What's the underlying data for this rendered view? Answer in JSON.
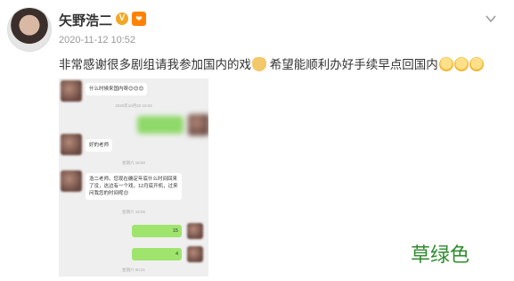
{
  "post": {
    "username": "矢野浩二",
    "verified_badge": "V",
    "timestamp": "2020-11-12 10:52",
    "text": "非常感谢很多剧组请我参加国内的戏",
    "text2": "希望能顺利办好手续早点回国内"
  },
  "chat": {
    "msg1": "什么时候来国内呀😊😊😊",
    "time1": "2020年10月22 15:04",
    "msg2": "好的老师",
    "time2": "星期六 18:50",
    "msg3": "浩二老师。您现在确定年底什么时间回来了没，这边有一个戏，12月底开机，过来问我您的时间呢😊",
    "time3": "星期六 19:06",
    "msg4": "15",
    "msg5": "4",
    "time4": "星期六 00:21"
  },
  "watermark": "草绿色"
}
